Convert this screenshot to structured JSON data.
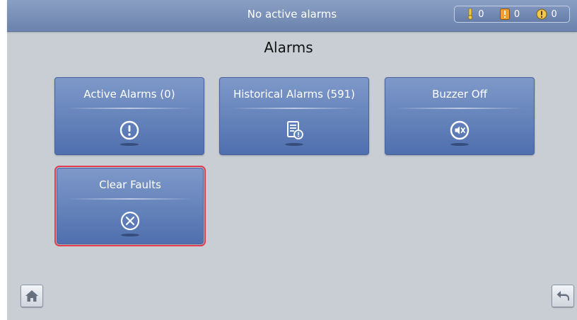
{
  "topbar": {
    "status_text": "No active alarms",
    "counters": [
      {
        "icon": "minor-alarm-icon",
        "count": "0",
        "color": "#f0c84a"
      },
      {
        "icon": "major-alarm-icon",
        "count": "0",
        "color": "#f0a030"
      },
      {
        "icon": "critical-alarm-icon",
        "count": "0",
        "color": "#e0503c"
      }
    ]
  },
  "page": {
    "title": "Alarms"
  },
  "tiles": [
    {
      "label": "Active Alarms (0)",
      "icon": "exclamation-circle-icon"
    },
    {
      "label": "Historical Alarms (591)",
      "icon": "history-log-icon"
    },
    {
      "label": "Buzzer Off",
      "icon": "mute-speaker-icon"
    },
    {
      "label": "Clear Faults",
      "icon": "clear-x-circle-icon",
      "selected": true
    }
  ],
  "nav": {
    "home_icon": "home-icon",
    "back_icon": "back-arrow-icon"
  },
  "colors": {
    "tile_top": "#7e99c9",
    "tile_bottom": "#4f6fae",
    "selection_border": "#e23a4f",
    "background": "#c9ced5"
  }
}
